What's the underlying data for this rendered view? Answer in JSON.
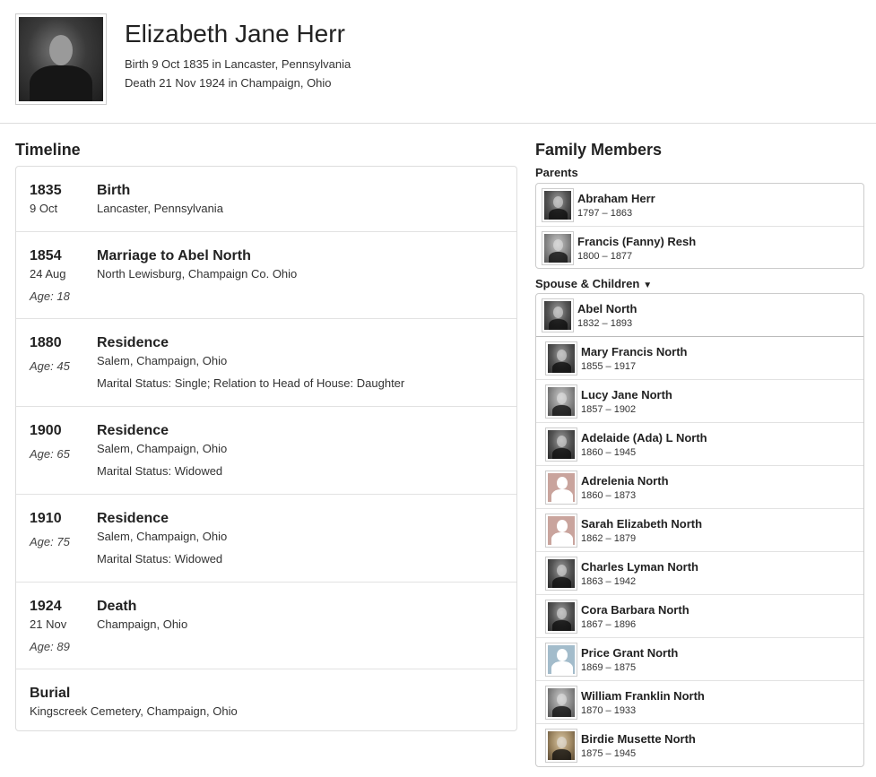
{
  "person": {
    "name": "Elizabeth Jane Herr",
    "birth_line": "Birth 9 Oct 1835 in Lancaster, Pennsylvania",
    "death_line": "Death 21 Nov 1924 in Champaign, Ohio"
  },
  "timeline": {
    "title": "Timeline",
    "events": [
      {
        "year": "1835",
        "date": "9 Oct",
        "age": "",
        "title": "Birth",
        "place": "Lancaster, Pennsylvania",
        "detail": ""
      },
      {
        "year": "1854",
        "date": "24 Aug",
        "age": "Age: 18",
        "title": "Marriage to Abel North",
        "place": "North Lewisburg, Champaign Co. Ohio",
        "detail": ""
      },
      {
        "year": "1880",
        "date": "",
        "age": "Age: 45",
        "title": "Residence",
        "place": "Salem, Champaign, Ohio",
        "detail": "Marital Status: Single; Relation to Head of House: Daughter"
      },
      {
        "year": "1900",
        "date": "",
        "age": "Age: 65",
        "title": "Residence",
        "place": "Salem, Champaign, Ohio",
        "detail": "Marital Status: Widowed"
      },
      {
        "year": "1910",
        "date": "",
        "age": "Age: 75",
        "title": "Residence",
        "place": "Salem, Champaign, Ohio",
        "detail": "Marital Status: Widowed"
      },
      {
        "year": "1924",
        "date": "21 Nov",
        "age": "Age: 89",
        "title": "Death",
        "place": "Champaign, Ohio",
        "detail": ""
      }
    ],
    "burial": {
      "title": "Burial",
      "place": "Kingscreek Cemetery, Champaign, Ohio"
    }
  },
  "family": {
    "title": "Family Members",
    "parents_label": "Parents",
    "spouse_label": "Spouse & Children",
    "dropdown_icon": "caret-down-icon",
    "parents": [
      {
        "name": "Abraham Herr",
        "dates": "1797 – 1863",
        "thumb": "photo"
      },
      {
        "name": "Francis (Fanny) Resh",
        "dates": "1800 – 1877",
        "thumb": "photo-light"
      }
    ],
    "spouse": {
      "name": "Abel North",
      "dates": "1832 – 1893",
      "thumb": "photo"
    },
    "children": [
      {
        "name": "Mary Francis North",
        "dates": "1855 – 1917",
        "thumb": "photo"
      },
      {
        "name": "Lucy Jane North",
        "dates": "1857 – 1902",
        "thumb": "photo-light"
      },
      {
        "name": "Adelaide (Ada) L North",
        "dates": "1860 – 1945",
        "thumb": "photo"
      },
      {
        "name": "Adrelenia North",
        "dates": "1860 – 1873",
        "thumb": "female-silhouette"
      },
      {
        "name": "Sarah Elizabeth North",
        "dates": "1862 – 1879",
        "thumb": "female-silhouette"
      },
      {
        "name": "Charles Lyman North",
        "dates": "1863 – 1942",
        "thumb": "photo"
      },
      {
        "name": "Cora Barbara North",
        "dates": "1867 – 1896",
        "thumb": "photo"
      },
      {
        "name": "Price Grant North",
        "dates": "1869 – 1875",
        "thumb": "male-silhouette"
      },
      {
        "name": "William Franklin North",
        "dates": "1870 – 1933",
        "thumb": "photo-light"
      },
      {
        "name": "Birdie Musette North",
        "dates": "1875 – 1945",
        "thumb": "photo-sepia"
      }
    ]
  },
  "colors": {
    "female_silhouette_bg": "#c9a49d",
    "male_silhouette_bg": "#a3bccb"
  }
}
